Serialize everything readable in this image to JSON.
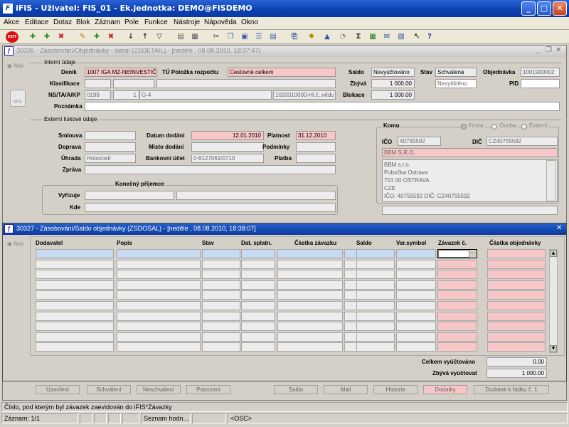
{
  "app": {
    "title": "iFIS - Uživatel: FIS_01 - Ek.jednotka: DEMO@FISDEMO",
    "icon_label": "F"
  },
  "menu": [
    "Akce",
    "Editace",
    "Dotaz",
    "Blok",
    "Záznam",
    "Pole",
    "Funkce",
    "Nástroje",
    "Nápověda",
    "Okno"
  ],
  "toolbar": {
    "exit_label": "EXIT"
  },
  "detail": {
    "title": "30335 - Zásobování/Objednávky - detail (ZSDETAIL) - [neděle , 08.08.2010, 18:37:47]",
    "nav": "Nav",
    "sfd": "SFD",
    "internal_title": "Interní údaje",
    "labels": {
      "denik": "Deník",
      "tu": "TÚ Položka rozpočtu",
      "klasifikace": "Klasifikace",
      "ns": "NS/TA/A/KP",
      "poznamka": "Poznámka",
      "saldo": "Saldo",
      "stav": "Stav",
      "objednavka": "Objednávka",
      "zbyva": "Zbývá",
      "pid": "PID",
      "blokace": "Blokace"
    },
    "values": {
      "denik": "1007 IGA MZ-NEINVESTIČ",
      "tu": "Cestovné celkem",
      "ns1": "0199",
      "ns2": "1",
      "ns3": "G-4",
      "ns4": "1020310000-Hl.č.,vědu",
      "saldo": "Nevyúčtováno",
      "stav": "Schválená",
      "objednavka": "1001900002",
      "zbyva": "1 000.00",
      "nevytisteno": "Nevytištěno",
      "blokace": "1 000.00"
    },
    "external_title": "Externí tiskové údaje",
    "ext_labels": {
      "smlouva": "Smlouva",
      "datum": "Datum dodání",
      "platnost": "Platnost",
      "doprava": "Doprava",
      "misto": "Místo dodání",
      "podminky": "Podmínky",
      "uhrada": "Úhrada",
      "ucet": "Bankovní účet",
      "platba": "Platba",
      "zprava": "Zpráva"
    },
    "ext_values": {
      "datum": "12.01.2010",
      "platnost": "31.12.2010",
      "uhrada": "Hotovostí",
      "ucet": "0-6127061/0710"
    },
    "prijemce": {
      "title": "Konečný příjemce",
      "vyrizuje": "Vyřizuje",
      "kde": "Kde"
    },
    "komu": {
      "title": "Komu",
      "firma": "Firma",
      "osoba": "Osoba",
      "externi": "Externí",
      "ico_label": "IČO",
      "ico": "40755592",
      "dic_label": "DIČ",
      "dic": "CZ40755592",
      "name": "BBM S.R.O.",
      "address": [
        "BBM s.r.o.",
        "Pobočka Ostrava",
        "701 00  OSTRAVA",
        "CZE",
        "IČO: 40755592    DIČ: CZ40755592"
      ]
    }
  },
  "saldo": {
    "title": "30327 - Zásobování/Saldo objednávky (ZSDOSAL) - [neděle , 08.08.2010, 18:38:07]",
    "nav": "Nav",
    "columns": [
      "Dodavatel",
      "Popis",
      "Stav",
      "Dat. splatn.",
      "Částka závazku",
      "Saldo",
      "Var.symbol",
      "Závazek č.",
      "Částka objednávky"
    ],
    "celkem_label": "Celkem vyúčtováno",
    "celkem": "0.00",
    "zbyva_label": "Zbývá vyúčtovat",
    "zbyva": "1 000.00",
    "more_label": "..."
  },
  "bottom_tabs": [
    "Uzavření",
    "Schválení",
    "Neschválení",
    "Potvrzení",
    "Saldo",
    "Mail",
    "Historie",
    "Dodatky",
    "Dodatek k řádku č. 1"
  ],
  "status": {
    "hint": "Číslo, pod kterým byl závazek zaevidován do iFIS*Závazky",
    "record": "Záznam: 1/1",
    "list": "Seznam hodn...",
    "osc": "<OSC>"
  }
}
